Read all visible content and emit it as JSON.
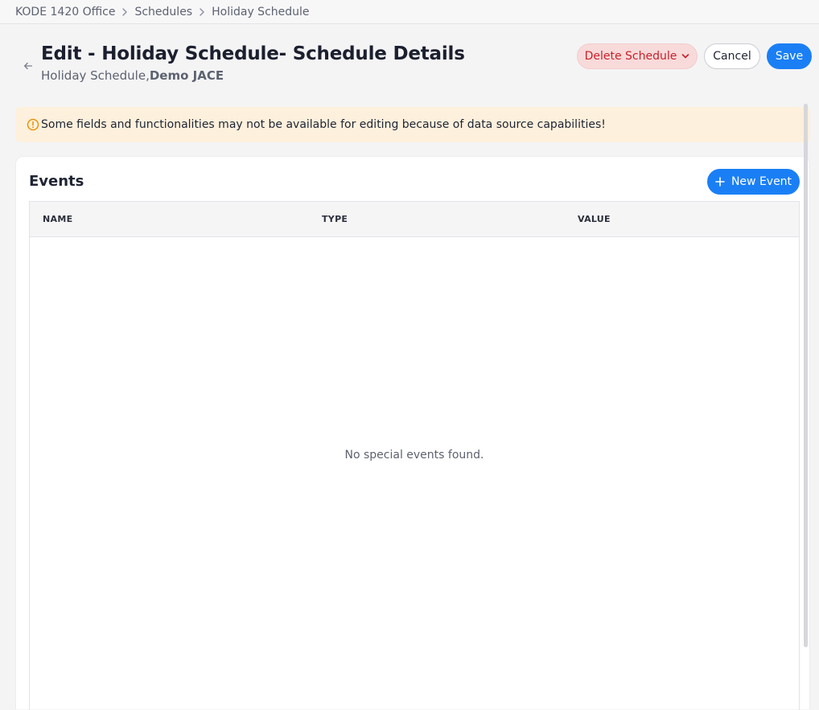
{
  "breadcrumb": {
    "items": [
      "KODE 1420 Office",
      "Schedules",
      "Holiday Schedule"
    ]
  },
  "header": {
    "title": "Edit - Holiday Schedule- Schedule Details",
    "subtitle_prefix": "Holiday Schedule,",
    "subtitle_bold": "Demo JACE"
  },
  "actions": {
    "delete_label": "Delete Schedule",
    "cancel_label": "Cancel",
    "save_label": "Save"
  },
  "warning": {
    "message": "Some fields and functionalities may not be available for editing because of data source capabilities!"
  },
  "events": {
    "title": "Events",
    "new_event_label": "New Event",
    "columns": [
      "NAME",
      "TYPE",
      "VALUE"
    ],
    "rows": [],
    "empty_message": "No special events found."
  },
  "colors": {
    "primary": "#1a7ff5",
    "danger_text": "#c8222b",
    "danger_bg": "#f8dada",
    "warning_bg": "#fdf0dc",
    "warning_icon": "#e8930c"
  },
  "icons": {
    "back": "arrow-left-icon",
    "breadcrumb_separator": "chevron-right-icon",
    "delete_dropdown": "chevron-down-icon",
    "warning": "alert-circle-icon",
    "new_event": "plus-icon"
  }
}
